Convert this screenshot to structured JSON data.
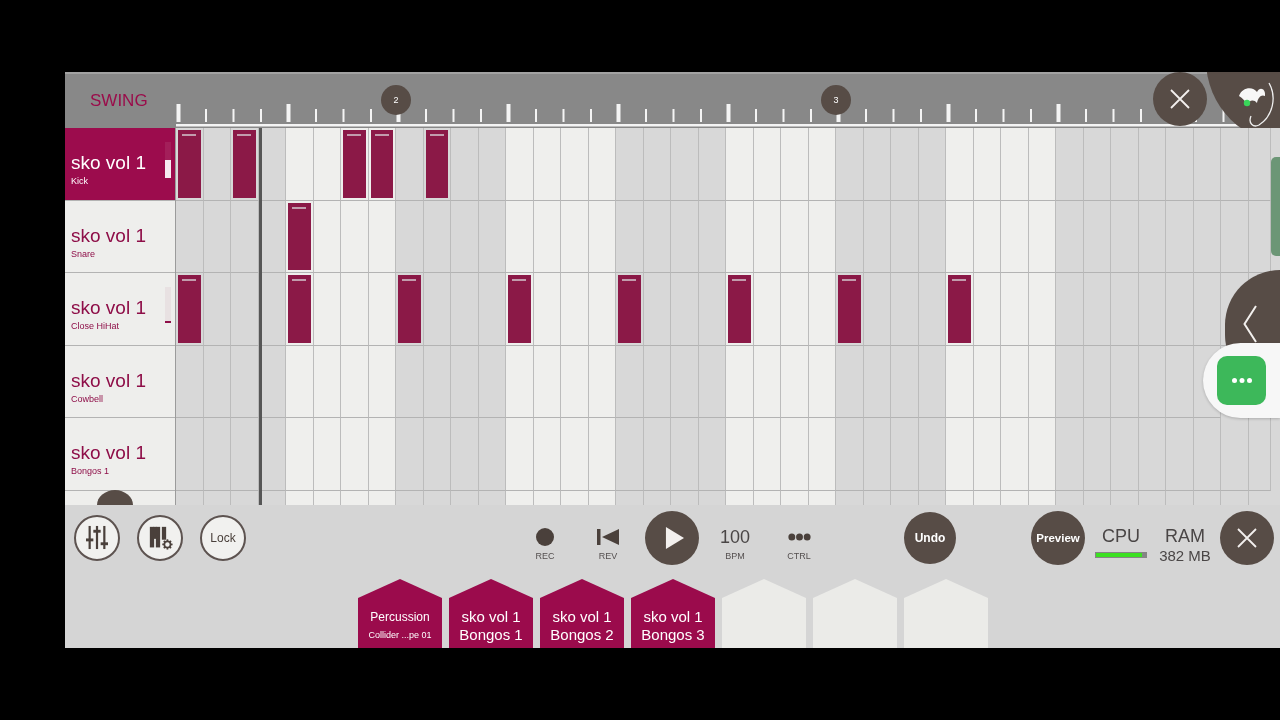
{
  "topbar": {
    "swing": "SWING"
  },
  "ruler": {
    "markers": [
      "2",
      "3"
    ]
  },
  "playhead": {
    "level": 0.077
  },
  "tracks": [
    {
      "name": "sko vol 1",
      "sample": "Kick",
      "selected": true,
      "level": 0.5,
      "steps": [
        {
          "on": true
        },
        {
          "on": false
        },
        {
          "on": true
        },
        {
          "on": false
        },
        {
          "on": false
        },
        {
          "on": false
        },
        {
          "on": true
        },
        {
          "on": true
        },
        {
          "on": false
        },
        {
          "on": true
        },
        {
          "on": false
        },
        {
          "on": false
        },
        {
          "on": false
        },
        {
          "on": false
        },
        {
          "on": false
        },
        {
          "on": false
        },
        {
          "on": false
        },
        {
          "on": false
        },
        {
          "on": false
        },
        {
          "on": false
        },
        {
          "on": false
        },
        {
          "on": false
        },
        {
          "on": false
        },
        {
          "on": false
        },
        {
          "on": false
        },
        {
          "on": false
        },
        {
          "on": false
        },
        {
          "on": false
        },
        {
          "on": false
        },
        {
          "on": false
        },
        {
          "on": false
        },
        {
          "on": false
        },
        {
          "on": false
        },
        {
          "on": false
        },
        {
          "on": false
        },
        {
          "on": false
        },
        {
          "on": false
        },
        {
          "on": false
        },
        {
          "on": false
        },
        {
          "on": false
        }
      ]
    },
    {
      "name": "sko vol 1",
      "sample": "Snare",
      "selected": false,
      "steps": [
        {
          "on": false
        },
        {
          "on": false
        },
        {
          "on": false
        },
        {
          "on": false
        },
        {
          "on": true
        },
        {
          "on": false
        },
        {
          "on": false
        },
        {
          "on": false
        },
        {
          "on": false
        },
        {
          "on": false
        },
        {
          "on": false
        },
        {
          "on": false
        },
        {
          "on": false
        },
        {
          "on": false
        },
        {
          "on": false
        },
        {
          "on": false
        },
        {
          "on": false
        },
        {
          "on": false
        },
        {
          "on": false
        },
        {
          "on": false
        },
        {
          "on": false
        },
        {
          "on": false
        },
        {
          "on": false
        },
        {
          "on": false
        },
        {
          "on": false
        },
        {
          "on": false
        },
        {
          "on": false
        },
        {
          "on": false
        },
        {
          "on": false
        },
        {
          "on": false
        },
        {
          "on": false
        },
        {
          "on": false
        },
        {
          "on": false
        },
        {
          "on": false
        },
        {
          "on": false
        },
        {
          "on": false
        },
        {
          "on": false
        },
        {
          "on": false
        },
        {
          "on": false
        },
        {
          "on": false
        }
      ]
    },
    {
      "name": "sko vol 1",
      "sample": "Close HiHat",
      "selected": false,
      "level": 0.06,
      "steps": [
        {
          "on": true
        },
        {
          "on": false
        },
        {
          "on": false
        },
        {
          "on": false
        },
        {
          "on": true
        },
        {
          "on": false
        },
        {
          "on": false
        },
        {
          "on": false
        },
        {
          "on": true
        },
        {
          "on": false
        },
        {
          "on": false
        },
        {
          "on": false
        },
        {
          "on": true
        },
        {
          "on": false
        },
        {
          "on": false
        },
        {
          "on": false
        },
        {
          "on": true
        },
        {
          "on": false
        },
        {
          "on": false
        },
        {
          "on": false
        },
        {
          "on": true
        },
        {
          "on": false
        },
        {
          "on": false
        },
        {
          "on": false
        },
        {
          "on": true
        },
        {
          "on": false
        },
        {
          "on": false
        },
        {
          "on": false
        },
        {
          "on": true
        },
        {
          "on": false
        },
        {
          "on": false
        },
        {
          "on": false
        },
        {
          "on": false
        },
        {
          "on": false
        },
        {
          "on": false
        },
        {
          "on": false
        },
        {
          "on": false
        },
        {
          "on": false
        },
        {
          "on": false
        },
        {
          "on": false
        }
      ]
    },
    {
      "name": "sko vol 1",
      "sample": "Cowbell",
      "selected": false,
      "steps": [
        {
          "on": false
        },
        {
          "on": false
        },
        {
          "on": false
        },
        {
          "on": false
        },
        {
          "on": false
        },
        {
          "on": false
        },
        {
          "on": false
        },
        {
          "on": false
        },
        {
          "on": false
        },
        {
          "on": false
        },
        {
          "on": false
        },
        {
          "on": false
        },
        {
          "on": false
        },
        {
          "on": false
        },
        {
          "on": false
        },
        {
          "on": false
        },
        {
          "on": false
        },
        {
          "on": false
        },
        {
          "on": false
        },
        {
          "on": false
        },
        {
          "on": false
        },
        {
          "on": false
        },
        {
          "on": false
        },
        {
          "on": false
        },
        {
          "on": false
        },
        {
          "on": false
        },
        {
          "on": false
        },
        {
          "on": false
        },
        {
          "on": false
        },
        {
          "on": false
        },
        {
          "on": false
        },
        {
          "on": false
        },
        {
          "on": false
        },
        {
          "on": false
        },
        {
          "on": false
        },
        {
          "on": false
        },
        {
          "on": false
        },
        {
          "on": false
        }
      ]
    },
    {
      "name": "sko vol 1",
      "sample": "Bongos 1",
      "selected": false,
      "steps": [
        {
          "on": false
        },
        {
          "on": false
        },
        {
          "on": false
        },
        {
          "on": false
        },
        {
          "on": false
        },
        {
          "on": false
        },
        {
          "on": false
        },
        {
          "on": false
        },
        {
          "on": false
        },
        {
          "on": false
        },
        {
          "on": false
        },
        {
          "on": false
        },
        {
          "on": false
        },
        {
          "on": false
        },
        {
          "on": false
        },
        {
          "on": false
        },
        {
          "on": false
        },
        {
          "on": false
        },
        {
          "on": false
        },
        {
          "on": false
        },
        {
          "on": false
        },
        {
          "on": false
        },
        {
          "on": false
        },
        {
          "on": false
        },
        {
          "on": false
        },
        {
          "on": false
        },
        {
          "on": false
        },
        {
          "on": false
        },
        {
          "on": false
        },
        {
          "on": false
        },
        {
          "on": false
        },
        {
          "on": false
        },
        {
          "on": false
        },
        {
          "on": false
        },
        {
          "on": false
        },
        {
          "on": false
        },
        {
          "on": false
        },
        {
          "on": false
        },
        {
          "on": false
        },
        {
          "on": false
        }
      ]
    }
  ],
  "toolbar": {
    "lock": "Lock",
    "record": "REC",
    "reverse": "REV",
    "tempo": "100",
    "tempo_unit": "BPM",
    "controls": "CTRL",
    "undo": "Undo",
    "preview": "Preview",
    "cpu": {
      "label": "CPU",
      "level": 0.92
    },
    "ram": {
      "label": "RAM",
      "value": "382 MB"
    }
  },
  "slots": [
    {
      "kind": "pack",
      "title": "Percussion",
      "subtitle": "Collider ...pe 01"
    },
    {
      "kind": "sample",
      "title": "sko vol 1",
      "subtitle": "Bongos 1"
    },
    {
      "kind": "sample",
      "title": "sko vol 1",
      "subtitle": "Bongos 2"
    },
    {
      "kind": "sample",
      "title": "sko vol 1",
      "subtitle": "Bongos 3"
    },
    {
      "kind": "empty"
    },
    {
      "kind": "empty"
    },
    {
      "kind": "empty"
    }
  ]
}
